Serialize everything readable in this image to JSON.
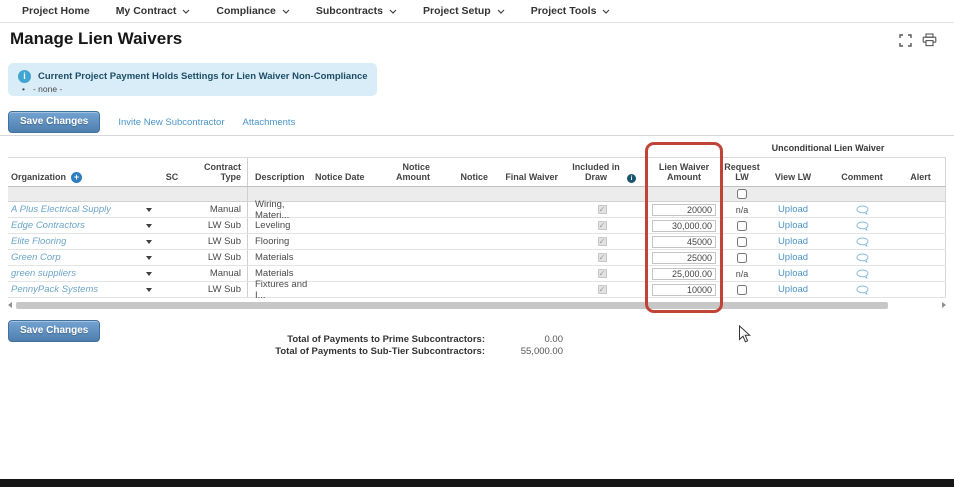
{
  "nav": {
    "items": [
      {
        "label": "Project Home",
        "dropdown": false
      },
      {
        "label": "My Contract",
        "dropdown": true
      },
      {
        "label": "Compliance",
        "dropdown": true
      },
      {
        "label": "Subcontracts",
        "dropdown": true
      },
      {
        "label": "Project Setup",
        "dropdown": true
      },
      {
        "label": "Project Tools",
        "dropdown": true
      }
    ]
  },
  "page": {
    "title": "Manage Lien Waivers"
  },
  "banner": {
    "title": "Current Project Payment Holds Settings for Lien Waiver Non-Compliance",
    "bullet": "- none -"
  },
  "toolbar": {
    "save": "Save Changes",
    "invite": "Invite New Subcontractor",
    "attachments": "Attachments"
  },
  "table": {
    "group_header": "Unconditional Lien Waiver",
    "headers": [
      "Organization",
      "SC",
      "Contract Type",
      "Description",
      "Notice Date",
      "Notice Amount",
      "Notice",
      "Final Waiver",
      "Included in Draw",
      "Lien Waiver Amount",
      "Request LW",
      "View LW",
      "Comment",
      "Alert"
    ],
    "rows": [
      {
        "org": "A Plus Electrical Supply",
        "contract_type": "Manual",
        "description": "Wiring, Materi...",
        "included_in_draw": true,
        "lw_amount": "20000",
        "request_lw": "n/a",
        "view_lw": "Upload"
      },
      {
        "org": "Edge Contractors",
        "contract_type": "LW Sub",
        "description": "Leveling",
        "included_in_draw": true,
        "lw_amount": "30,000.00",
        "request_lw": "",
        "view_lw": "Upload"
      },
      {
        "org": "Elite Flooring",
        "contract_type": "LW Sub",
        "description": "Flooring",
        "included_in_draw": true,
        "lw_amount": "45000",
        "request_lw": "",
        "view_lw": "Upload"
      },
      {
        "org": "Green Corp",
        "contract_type": "LW Sub",
        "description": "Materials",
        "included_in_draw": true,
        "lw_amount": "25000",
        "request_lw": "",
        "view_lw": "Upload"
      },
      {
        "org": "green suppliers",
        "contract_type": "Manual",
        "description": "Materials",
        "included_in_draw": true,
        "lw_amount": "25,000.00",
        "request_lw": "n/a",
        "view_lw": "Upload"
      },
      {
        "org": "PennyPack Systems",
        "contract_type": "LW Sub",
        "description": "Fixtures and I...",
        "included_in_draw": true,
        "lw_amount": "10000",
        "request_lw": "",
        "view_lw": "Upload"
      }
    ]
  },
  "footer": {
    "save": "Save Changes",
    "totals": [
      {
        "label": "Total of Payments to Prime Subcontractors:",
        "value": "0.00"
      },
      {
        "label": "Total of Payments to Sub-Tier Subcontractors:",
        "value": "55,000.00"
      }
    ]
  },
  "colors": {
    "accent_blue": "#4b96c8",
    "highlight_red": "#bf4437",
    "banner_bg": "#d9edf8",
    "button_blue": "#4d7fae"
  }
}
